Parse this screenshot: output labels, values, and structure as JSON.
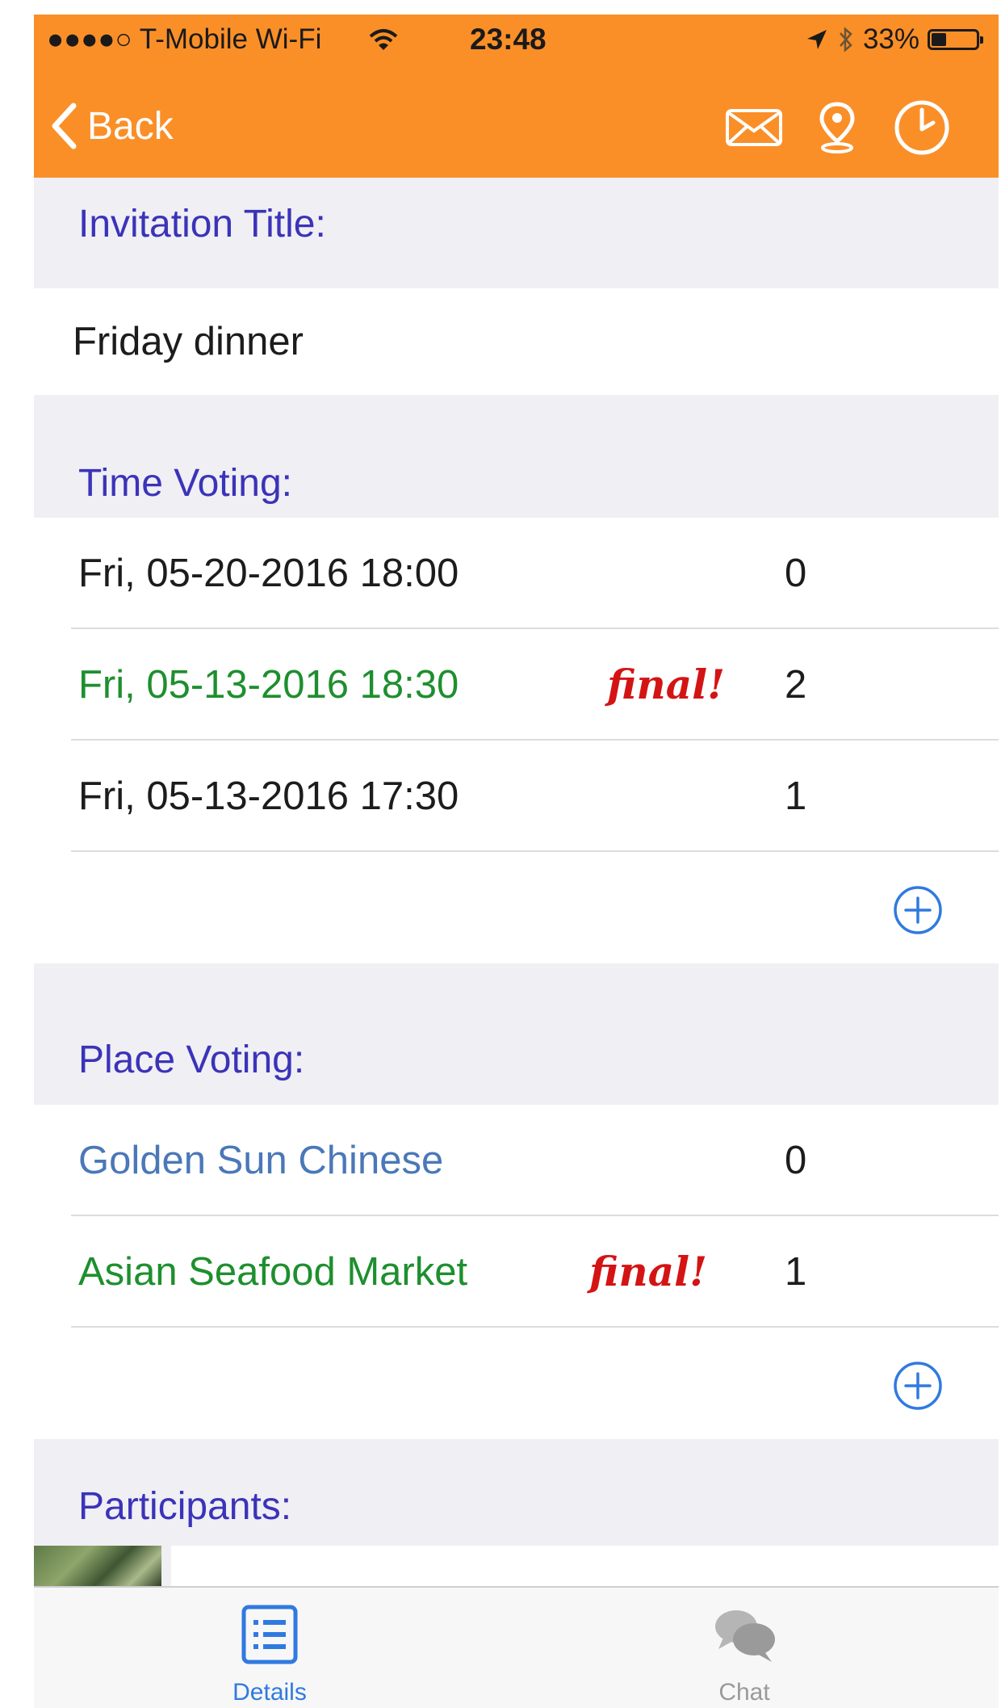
{
  "status_bar": {
    "carrier": "●●●●○ T-Mobile Wi-Fi",
    "time": "23:48",
    "battery": "33%",
    "battery_level": 0.33
  },
  "nav": {
    "back_label": "Back"
  },
  "invitation": {
    "header": "Invitation Title:",
    "title": "Friday dinner"
  },
  "time_voting": {
    "header": "Time Voting:",
    "options": [
      {
        "label": "Fri, 05-20-2016 18:00",
        "votes": "0",
        "final": ""
      },
      {
        "label": "Fri, 05-13-2016 18:30",
        "votes": "2",
        "final": "final!"
      },
      {
        "label": "Fri, 05-13-2016 17:30",
        "votes": "1",
        "final": ""
      }
    ]
  },
  "place_voting": {
    "header": "Place Voting:",
    "options": [
      {
        "label": "Golden Sun Chinese",
        "votes": "0",
        "final": ""
      },
      {
        "label": "Asian Seafood Market",
        "votes": "1",
        "final": "final!"
      }
    ]
  },
  "participants": {
    "header": "Participants:"
  },
  "tab_bar": {
    "tabs": [
      {
        "label": "Details",
        "icon": "list-icon",
        "active": true
      },
      {
        "label": "Chat",
        "icon": "chat-bubbles-icon",
        "active": false
      }
    ]
  },
  "colors": {
    "accent": "#fa8f28",
    "header_text": "#3b33b8",
    "final_text": "#d41414",
    "selected_green": "#1e8f2e",
    "link_blue": "#4a78b8",
    "tab_active": "#2f7ae0",
    "tab_inactive": "#9a9a9a"
  }
}
